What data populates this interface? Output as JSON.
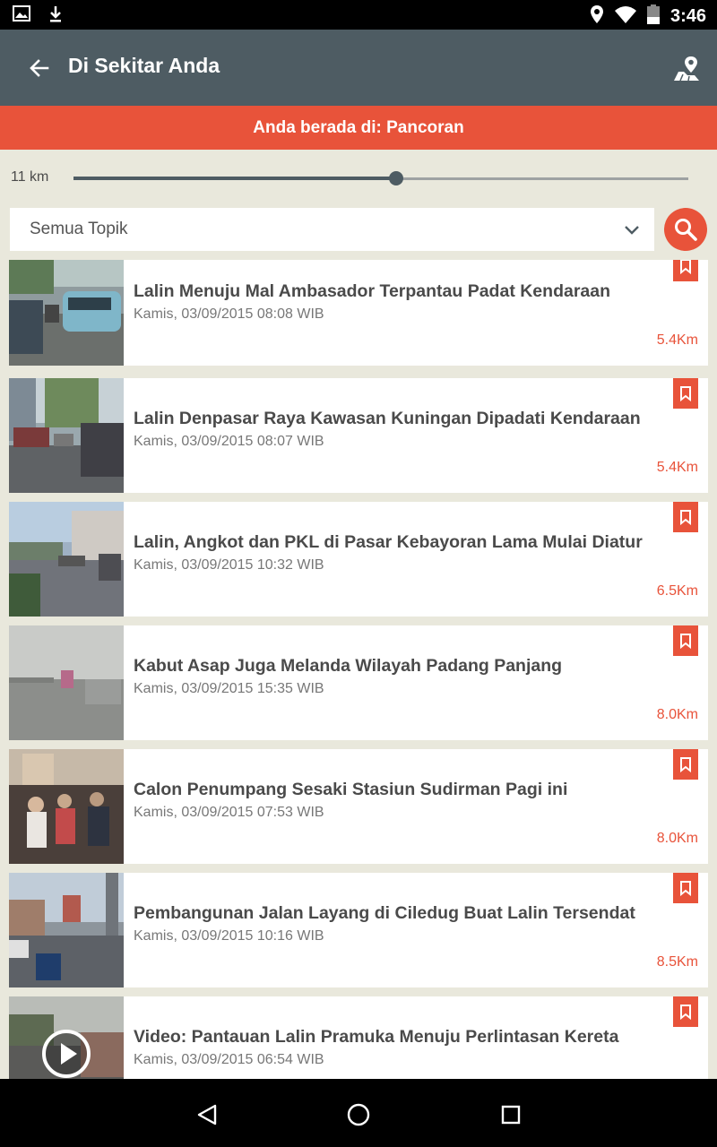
{
  "status_bar": {
    "time": "3:46",
    "icons": [
      "image-notification-icon",
      "download-icon",
      "location-icon",
      "wifi-icon",
      "battery-icon"
    ]
  },
  "app_bar": {
    "title": "Di Sekitar Anda",
    "back_icon": "arrow-left-icon",
    "map_icon": "map-pin-icon",
    "background": "#4e5c63"
  },
  "location_banner": {
    "text": "Anda berada di: Pancoran",
    "color": "#e8533a"
  },
  "range": {
    "label": "11 km",
    "value_fraction": 0.525
  },
  "filter": {
    "topic": "Semua Topik",
    "search_icon": "search-icon"
  },
  "news": [
    {
      "title": "Lalin Menuju Mal Ambasador Terpantau Padat Kendaraan",
      "date": "Kamis, 03/09/2015 08:08 WIB",
      "distance": "5.4Km"
    },
    {
      "title": "Lalin Denpasar Raya Kawasan Kuningan Dipadati Kendaraan",
      "date": "Kamis, 03/09/2015 08:07 WIB",
      "distance": "5.4Km"
    },
    {
      "title": "Lalin, Angkot dan PKL di Pasar Kebayoran Lama Mulai Diatur",
      "date": "Kamis, 03/09/2015 10:32 WIB",
      "distance": "6.5Km"
    },
    {
      "title": "Kabut Asap Juga Melanda Wilayah Padang Panjang",
      "date": "Kamis, 03/09/2015 15:35 WIB",
      "distance": "8.0Km"
    },
    {
      "title": "Calon Penumpang Sesaki Stasiun Sudirman Pagi ini",
      "date": "Kamis, 03/09/2015 07:53 WIB",
      "distance": "8.0Km"
    },
    {
      "title": "Pembangunan Jalan Layang di Ciledug Buat Lalin Tersendat",
      "date": "Kamis, 03/09/2015 10:16 WIB",
      "distance": "8.5Km"
    },
    {
      "title": "Video: Pantauan Lalin Pramuka Menuju Perlintasan Kereta",
      "date": "Kamis, 03/09/2015 06:54 WIB",
      "distance": ""
    }
  ],
  "nav_bar": {
    "icons": [
      "back-triangle-icon",
      "home-circle-icon",
      "recents-square-icon"
    ]
  }
}
